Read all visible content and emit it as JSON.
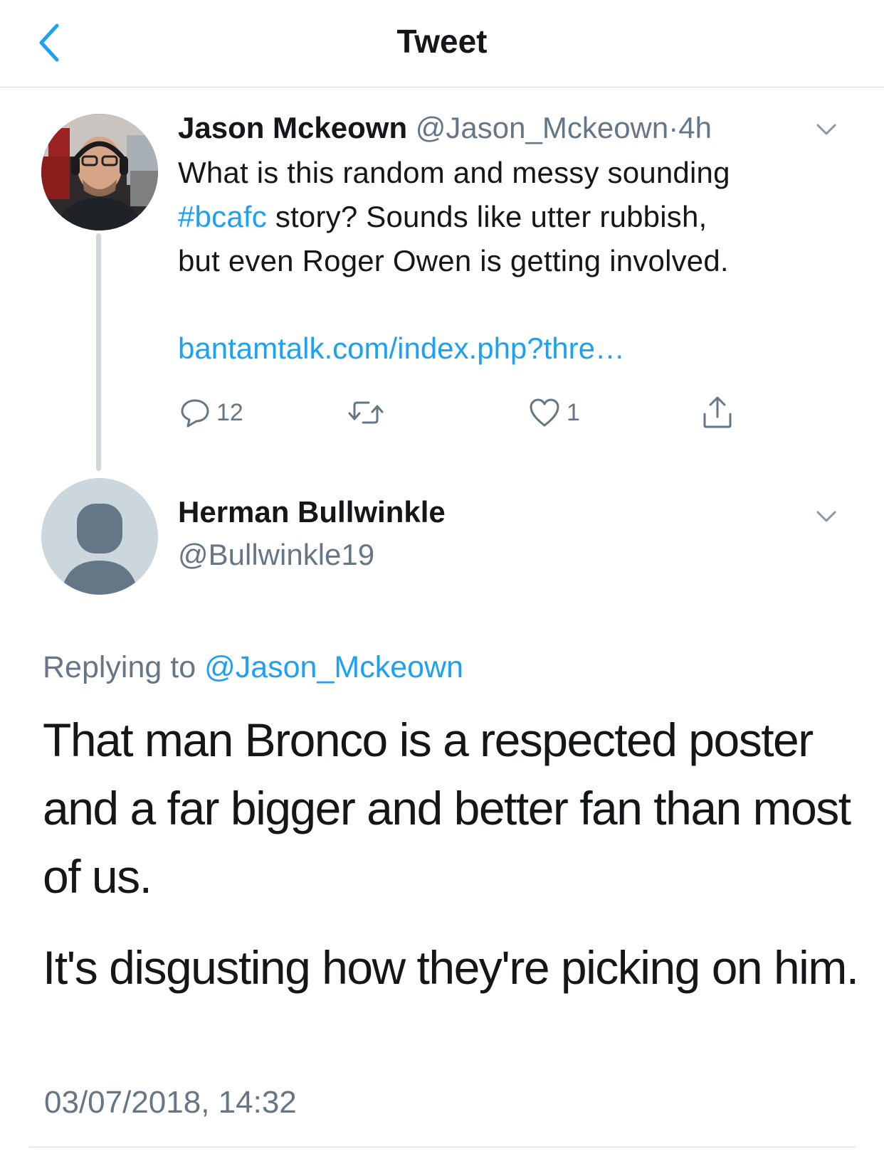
{
  "header": {
    "title": "Tweet",
    "back_icon": "chevron-left-icon"
  },
  "parent_tweet": {
    "author_name": "Jason Mckeown",
    "author_handle": "@Jason_Mckeown",
    "separator": "·",
    "age": "4h",
    "text_segments": {
      "line1": "What is this random and messy sounding",
      "hashtag": "#bcafc",
      "line2": " story? Sounds like utter rubbish,",
      "line3": "but even Roger Owen is getting involved."
    },
    "link": "bantamtalk.com/index.php?thre…",
    "actions": {
      "reply_count": "12",
      "retweet_count": "",
      "like_count": "1"
    }
  },
  "reply_tweet": {
    "author_name": "Herman Bullwinkle",
    "author_handle": "@Bullwinkle19",
    "replying_prefix": "Replying to ",
    "replying_handle": "@Jason_Mckeown",
    "paragraphs": [
      "That man Bronco is a respected poster and a far bigger and better fan than most of us.",
      "It's disgusting how they're picking on him."
    ],
    "timestamp": "03/07/2018, 14:32"
  },
  "colors": {
    "accent": "#1da1f2",
    "secondary_text": "#657786",
    "primary_text": "#14171a",
    "thread_line": "#cfd6dc",
    "default_avatar_bg": "#ccd6dd",
    "default_avatar_fg": "#657786"
  }
}
